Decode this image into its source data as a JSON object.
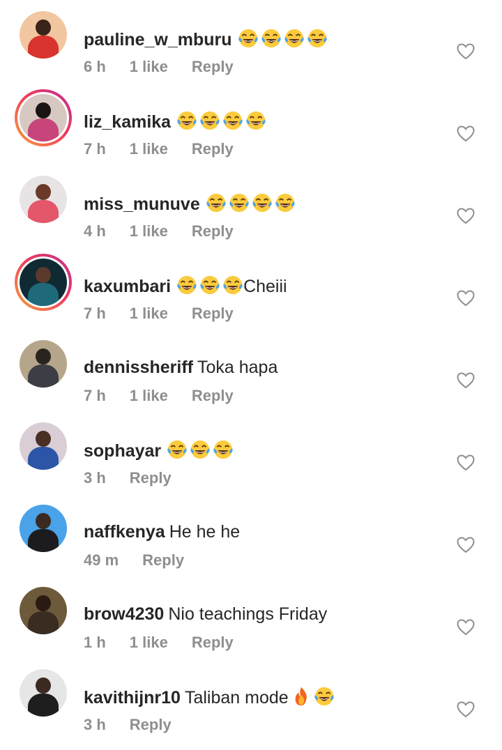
{
  "comments": [
    {
      "username": "pauline_w_mburu",
      "text": "",
      "emojis": [
        "tears-of-joy",
        "tears-of-joy",
        "tears-of-joy",
        "tears-of-joy"
      ],
      "time": "6 h",
      "likes": "1 like",
      "reply": "Reply",
      "story": false,
      "avatar_colors": [
        "#f2c6a0",
        "#3a2318",
        "#d8332f"
      ]
    },
    {
      "username": "liz_kamika",
      "text": "",
      "emojis": [
        "tears-of-joy",
        "tears-of-joy",
        "tears-of-joy",
        "tears-of-joy"
      ],
      "time": "7 h",
      "likes": "1 like",
      "reply": "Reply",
      "story": true,
      "avatar_colors": [
        "#d7c9c2",
        "#1a1414",
        "#c7457a"
      ]
    },
    {
      "username": "miss_munuve",
      "text": "",
      "emojis": [
        "tears-of-joy",
        "tears-of-joy",
        "tears-of-joy",
        "tears-of-joy"
      ],
      "time": "4 h",
      "likes": "1 like",
      "reply": "Reply",
      "story": false,
      "avatar_colors": [
        "#e8e4e6",
        "#6a3a28",
        "#e4566a"
      ]
    },
    {
      "username": "kaxumbari",
      "text": "Cheiii",
      "emojis": [
        "tears-of-joy",
        "tears-of-joy",
        "tears-of-joy"
      ],
      "time": "7 h",
      "likes": "1 like",
      "reply": "Reply",
      "story": true,
      "avatar_colors": [
        "#0f2a33",
        "#5b3a2c",
        "#1f6a7a"
      ]
    },
    {
      "username": "dennissheriff",
      "text": "Toka hapa",
      "emojis": [],
      "time": "7 h",
      "likes": "1 like",
      "reply": "Reply",
      "story": false,
      "avatar_colors": [
        "#b5a68b",
        "#2a2420",
        "#3d3e45"
      ]
    },
    {
      "username": "sophayar",
      "text": "",
      "emojis": [
        "tears-of-joy",
        "tears-of-joy",
        "tears-of-joy"
      ],
      "time": "3 h",
      "likes": "",
      "reply": "Reply",
      "story": false,
      "avatar_colors": [
        "#d9ced6",
        "#4a2f24",
        "#2c55a8"
      ]
    },
    {
      "username": "naffkenya",
      "text": "He he he",
      "emojis": [],
      "time": "49 m",
      "likes": "",
      "reply": "Reply",
      "story": false,
      "avatar_colors": [
        "#4aa2e8",
        "#3a2a22",
        "#1c1c1e"
      ]
    },
    {
      "username": "brow4230",
      "text": "Nio teachings Friday",
      "emojis": [],
      "time": "1 h",
      "likes": "1 like",
      "reply": "Reply",
      "story": false,
      "avatar_colors": [
        "#6d5a3a",
        "#2a1a12",
        "#3b2c22"
      ]
    },
    {
      "username": "kavithijnr10",
      "text": "Taliban mode",
      "emojis": [
        "fire",
        "tears-of-joy"
      ],
      "time": "3 h",
      "likes": "",
      "reply": "Reply",
      "story": false,
      "avatar_colors": [
        "#e6e6e6",
        "#3c2a22",
        "#1e1e1e"
      ]
    }
  ],
  "colors": {
    "primary_text": "#262626",
    "secondary_text": "#8e8e8e",
    "story_ring_start": "#f9a23a",
    "story_ring_end": "#c02f8f"
  },
  "icons": {
    "like": "heart-outline-icon"
  }
}
